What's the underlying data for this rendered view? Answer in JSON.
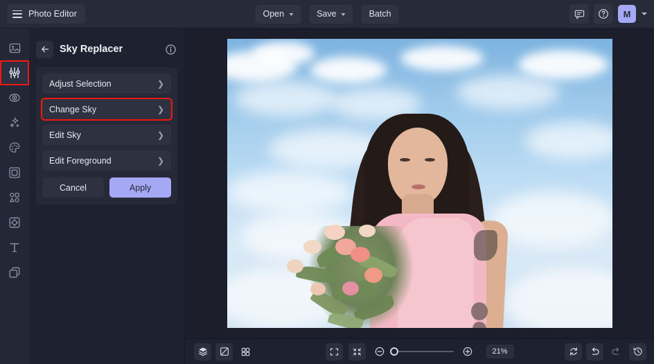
{
  "app": {
    "name": "Photo Editor",
    "accent_purple": "#a5a8f5",
    "highlight_red": "#f0180f",
    "panel_bg": "#1e2130",
    "topbar_bg": "#272a38"
  },
  "topbar": {
    "menu_icon": "hamburger-icon",
    "brand_label": "Photo Editor",
    "tools": [
      {
        "label": "Open",
        "has_caret": true
      },
      {
        "label": "Save",
        "has_caret": true
      },
      {
        "label": "Batch",
        "has_caret": false
      }
    ],
    "feedback_icon": "comment-icon",
    "help_icon": "question-circle-icon",
    "avatar_initial": "M",
    "account_caret": "chevron-down-icon"
  },
  "rail": {
    "items": [
      {
        "icon": "image-icon",
        "label": "Image",
        "active": false
      },
      {
        "icon": "sliders-icon",
        "label": "Adjust",
        "active": true
      },
      {
        "icon": "eye-retouch-icon",
        "label": "Retouch",
        "active": false
      },
      {
        "icon": "sparkles-icon",
        "label": "Effects",
        "active": false
      },
      {
        "icon": "palette-icon",
        "label": "Color",
        "active": false
      },
      {
        "icon": "frame-icon",
        "label": "Frame",
        "active": false
      },
      {
        "icon": "shapes-icon",
        "label": "Shapes",
        "active": false
      },
      {
        "icon": "sticker-icon",
        "label": "Sticker",
        "active": false
      },
      {
        "icon": "text-icon",
        "label": "Text",
        "active": false
      },
      {
        "icon": "layers-stack-icon",
        "label": "Layers",
        "active": false
      }
    ]
  },
  "panel": {
    "back_icon": "arrow-left-icon",
    "title": "Sky Replacer",
    "info_icon": "info-circle-icon",
    "menu_items": [
      {
        "label": "Adjust Selection",
        "highlighted": false,
        "chevron": "chevron-right-icon"
      },
      {
        "label": "Change Sky",
        "highlighted": true,
        "chevron": "chevron-right-icon"
      },
      {
        "label": "Edit Sky",
        "highlighted": false,
        "chevron": "chevron-right-icon"
      },
      {
        "label": "Edit Foreground",
        "highlighted": false,
        "chevron": "chevron-right-icon"
      }
    ],
    "cancel_label": "Cancel",
    "apply_label": "Apply"
  },
  "canvas": {
    "image_description": "Woman in pink dress with arm tattoos holding a bouquet of pink and cream flowers against a blue sky with white clouds"
  },
  "bottombar": {
    "left_icons": [
      {
        "icon": "layers-icon",
        "filled": true
      },
      {
        "icon": "compare-split-icon",
        "filled": true
      },
      {
        "icon": "grid-view-icon",
        "filled": false
      }
    ],
    "center_icons": [
      {
        "icon": "fit-screen-icon",
        "filled": true
      },
      {
        "icon": "collapse-screen-icon",
        "filled": true
      }
    ],
    "zoom_out_icon": "minus-circle-icon",
    "zoom_in_icon": "plus-circle-icon",
    "zoom_value": "21%",
    "slider_position_percent": 0,
    "right_icons": [
      {
        "icon": "reset-rotate-icon",
        "filled": true,
        "disabled": false
      },
      {
        "icon": "undo-icon",
        "filled": true,
        "disabled": false
      },
      {
        "icon": "redo-icon",
        "filled": false,
        "disabled": true
      },
      {
        "icon": "history-icon",
        "filled": true,
        "disabled": false
      }
    ]
  }
}
